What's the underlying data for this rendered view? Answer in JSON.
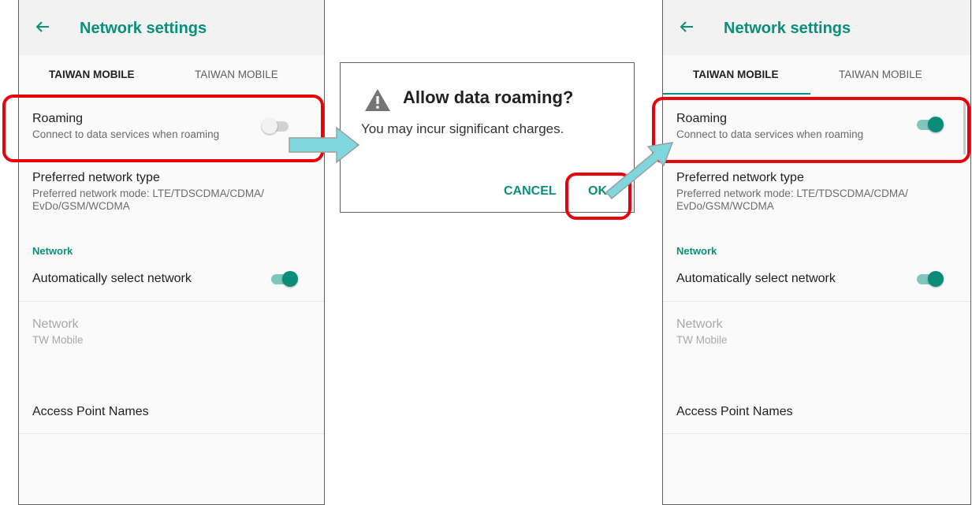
{
  "screen_left": {
    "title": "Network settings",
    "tabs": [
      "TAIWAN MOBILE",
      "TAIWAN MOBILE"
    ],
    "roaming": {
      "title": "Roaming",
      "summary": "Connect to data services when roaming",
      "enabled": false
    },
    "preferred": {
      "title": "Preferred network type",
      "summary_line1": "Preferred network mode: LTE/TDSCDMA/CDMA/",
      "summary_line2": "EvDo/GSM/WCDMA"
    },
    "section": "Network",
    "auto_select": {
      "title": "Automatically select network",
      "enabled": true
    },
    "network": {
      "title": "Network",
      "summary": "TW Mobile"
    },
    "apn": {
      "title": "Access Point Names"
    }
  },
  "dialog": {
    "title": "Allow data roaming?",
    "message": "You may incur significant charges.",
    "cancel_label": "CANCEL",
    "ok_label": "OK"
  },
  "screen_right": {
    "title": "Network settings",
    "tabs": [
      "TAIWAN MOBILE",
      "TAIWAN MOBILE"
    ],
    "roaming": {
      "title": "Roaming",
      "summary": "Connect to data services when roaming",
      "enabled": true
    },
    "preferred": {
      "title": "Preferred network type",
      "summary_line1": "Preferred network mode: LTE/TDSCDMA/CDMA/",
      "summary_line2": "EvDo/GSM/WCDMA"
    },
    "section": "Network",
    "auto_select": {
      "title": "Automatically select network",
      "enabled": true
    },
    "network": {
      "title": "Network",
      "summary": "TW Mobile"
    },
    "apn": {
      "title": "Access Point Names"
    }
  },
  "colors": {
    "accent": "#08907b",
    "highlight": "#e8000b",
    "arrow": "#7fd6dc"
  },
  "icons": [
    "back-arrow-icon",
    "warning-icon",
    "right-arrow-icon"
  ]
}
